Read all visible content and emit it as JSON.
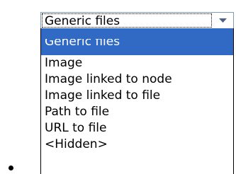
{
  "combo": {
    "selected_value": "Generic files",
    "arrow_icon": "chevron-down-icon"
  },
  "dropdown": {
    "options": [
      {
        "label": "Generic files",
        "selected": true
      },
      {
        "label": "Image",
        "selected": false
      },
      {
        "label": "Image linked to node",
        "selected": false
      },
      {
        "label": "Image linked to file",
        "selected": false
      },
      {
        "label": "Path to file",
        "selected": false
      },
      {
        "label": "URL to file",
        "selected": false
      },
      {
        "label": "<Hidden>",
        "selected": false
      }
    ]
  },
  "colors": {
    "highlight": "#316ac5",
    "border": "#7f9db9"
  }
}
